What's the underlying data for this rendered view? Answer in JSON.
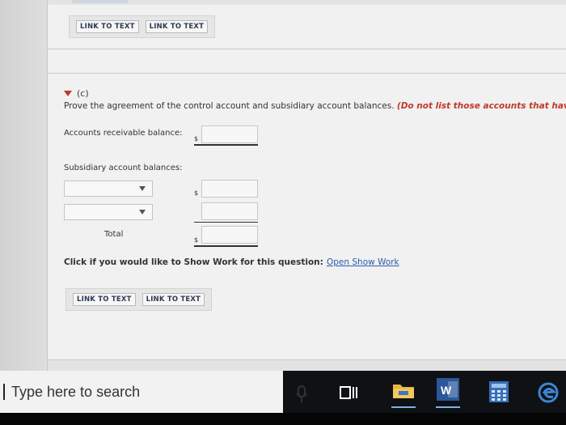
{
  "top_links": [
    "LINK TO TEXT",
    "LINK TO TEXT"
  ],
  "part": {
    "label": "(c)",
    "instruction": "Prove the agreement of the control account and subsidiary account balances.",
    "hint": "(Do not list those accounts that have ze"
  },
  "form": {
    "ar_balance_label": "Accounts receivable balance:",
    "subsidiary_label": "Subsidiary account balances:",
    "total_label": "Total",
    "currency": "$",
    "ar_balance_value": "",
    "sub_row1_value": "",
    "sub_row2_value": "",
    "total_value": ""
  },
  "show_work": {
    "prompt": "Click if you would like to Show Work for this question:",
    "link": "Open Show Work"
  },
  "bottom_links": [
    "LINK TO TEXT",
    "LINK TO TEXT"
  ],
  "taskbar": {
    "search_placeholder": "Type here to search",
    "word_letter": "W"
  }
}
